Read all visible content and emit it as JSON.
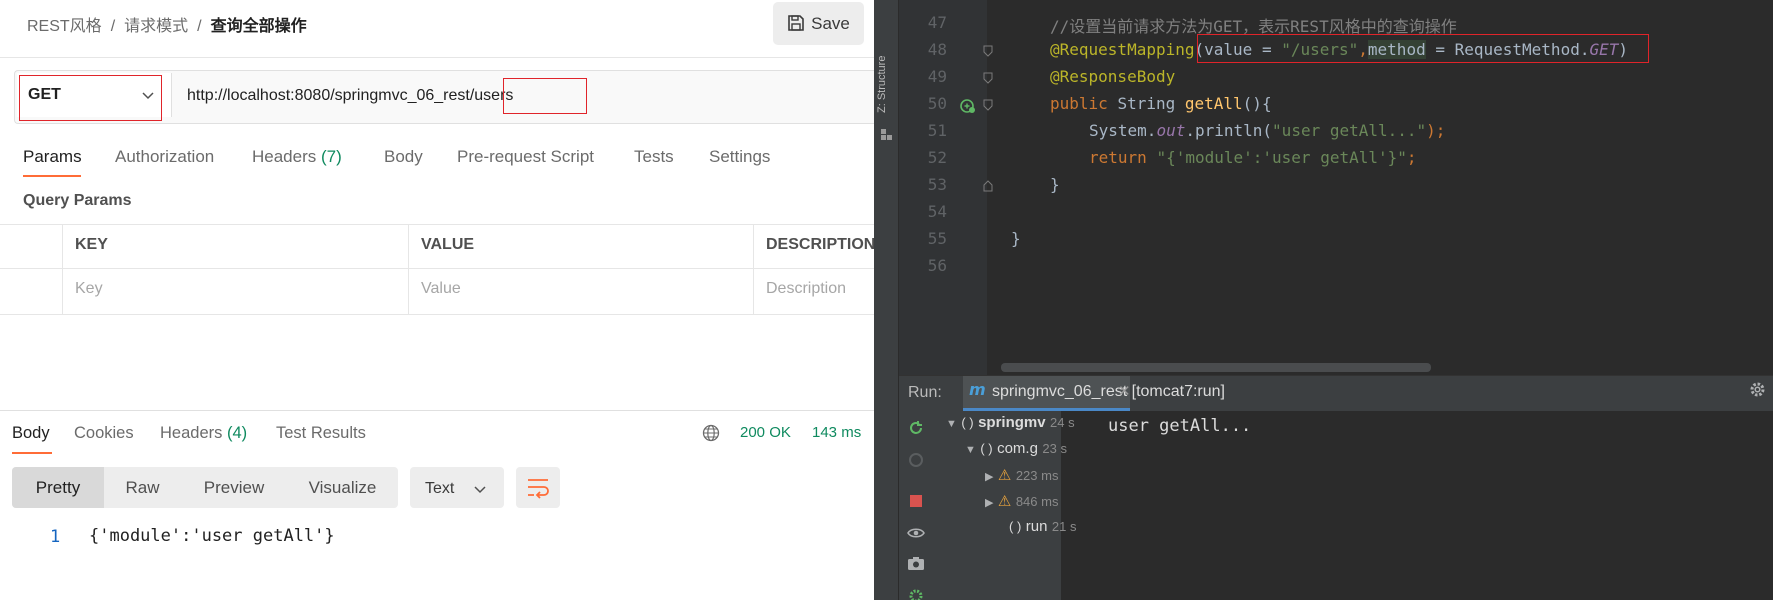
{
  "postman": {
    "breadcrumb": [
      "REST风格",
      "请求模式",
      "查询全部操作"
    ],
    "save_label": "Save",
    "request": {
      "method": "GET",
      "url_prefix": "http://localhost:8080/springmvc_06_rest",
      "url_highlight": "/users"
    },
    "request_tabs": {
      "params": "Params",
      "authorization": "Authorization",
      "headers": "Headers",
      "headers_count": "(7)",
      "body": "Body",
      "prerequest": "Pre-request Script",
      "tests": "Tests",
      "settings": "Settings"
    },
    "query_params": {
      "title": "Query Params",
      "columns": [
        "KEY",
        "VALUE",
        "DESCRIPTION"
      ],
      "placeholders": [
        "Key",
        "Value",
        "Description"
      ]
    },
    "response": {
      "tabs": {
        "body": "Body",
        "cookies": "Cookies",
        "headers": "Headers",
        "headers_count": "(4)",
        "test_results": "Test Results"
      },
      "status": "200 OK",
      "time": "143 ms",
      "views": [
        "Pretty",
        "Raw",
        "Preview",
        "Visualize"
      ],
      "format": "Text",
      "line_number": "1",
      "body_text": "{'module':'user getAll'}"
    },
    "accent_color": "#ff6c37",
    "highlight_color": "#e0242a"
  },
  "ide": {
    "structure_label": "Z: Structure",
    "lines": [
      "47",
      "48",
      "49",
      "50",
      "51",
      "52",
      "53",
      "54",
      "55",
      "56"
    ],
    "code": {
      "l47": "//设置当前请求方法为GET，表示REST风格中的查询操作",
      "l48_annot": "@RequestMapping",
      "l48_open": "(",
      "l48_value": "value = ",
      "l48_str": "\"/users\"",
      "l48_comma": ",",
      "l48_method": "method",
      "l48_eq": " = RequestMethod.",
      "l48_get": "GET",
      "l48_close": ")",
      "l49": "@ResponseBody",
      "l50_kw": "public ",
      "l50_type": "String ",
      "l50_fn": "getAll",
      "l50_rest": "(){",
      "l51_a": "System.",
      "l51_b": "out",
      "l51_c": ".println(",
      "l51_str": "\"user getAll...\"",
      "l51_d": ");",
      "l52_kw": "return ",
      "l52_str": "\"{'module':'user getAll'}\"",
      "l52_end": ";",
      "l53": "}",
      "l55": "}"
    },
    "run": {
      "label": "Run:",
      "tab_name": "springmvc_06_rest [tomcat7:run]",
      "tree": [
        {
          "name": "springmv",
          "time": "24 s"
        },
        {
          "name": "com.g",
          "time": "23 s"
        },
        {
          "name": "",
          "time": "223 ms"
        },
        {
          "name": "",
          "time": "846 ms"
        },
        {
          "name": "run",
          "time": "21 s"
        }
      ],
      "console_output": "user getAll..."
    }
  }
}
